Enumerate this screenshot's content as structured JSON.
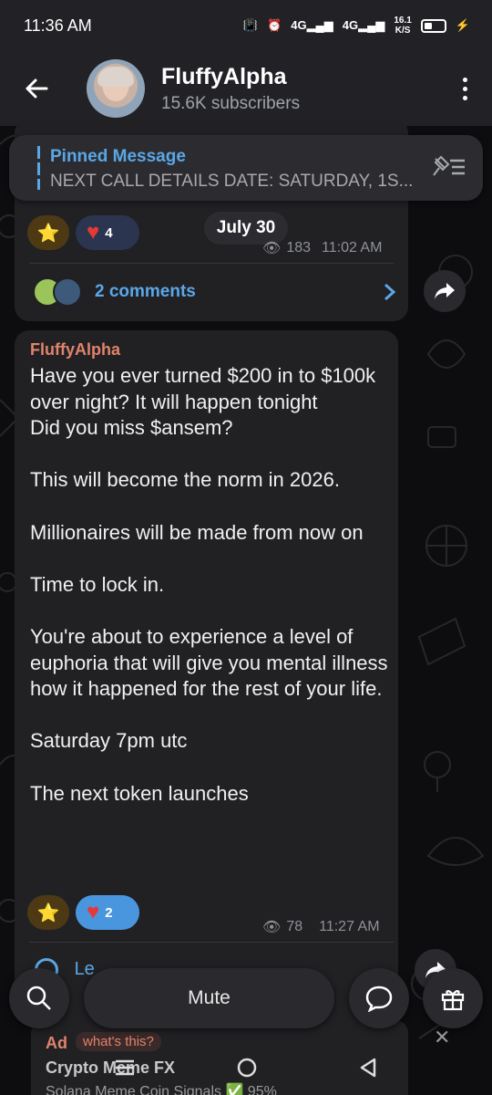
{
  "status": {
    "time": "11:36 AM",
    "net1": "4G",
    "net2": "4G",
    "speed_value": "16.1",
    "speed_unit": "K/S"
  },
  "header": {
    "channel_name": "FluffyAlpha",
    "subscribers": "15.6K subscribers"
  },
  "pinned": {
    "title": "Pinned Message",
    "text": "NEXT CALL DETAILS    DATE: SATURDAY, 1S..."
  },
  "prev_message": {
    "star_reaction": "⭐",
    "heart_count": "4",
    "date": "July 30",
    "views": "183",
    "time": "11:02 AM",
    "comments": "2 comments"
  },
  "message": {
    "sender": "FluffyAlpha",
    "text": "Have you ever turned $200 in to $100k  over night? It will happen tonight\nDid you miss $ansem?\n\nThis will become the norm in 2026.\n\nMillionaires will be made from now on\n\nTime to lock in.\n\nYou're about to experience a level of euphoria that will give you mental illness how it happened for the rest of your life.\n\nSaturday 7pm utc\n\nThe next token launches",
    "heart_count": "2",
    "views": "78",
    "time": "11:27 AM",
    "leave_comment": "Le"
  },
  "bottom": {
    "mute_label": "Mute"
  },
  "ad": {
    "label": "Ad",
    "whats_this": "what's this?",
    "title": "Crypto Meme FX",
    "subtitle": "Solana Meme Coin Signals ✅ 95%"
  },
  "colors": {
    "accent": "#5aa7e8",
    "sender": "#e1836b",
    "bubble": "#212124"
  }
}
